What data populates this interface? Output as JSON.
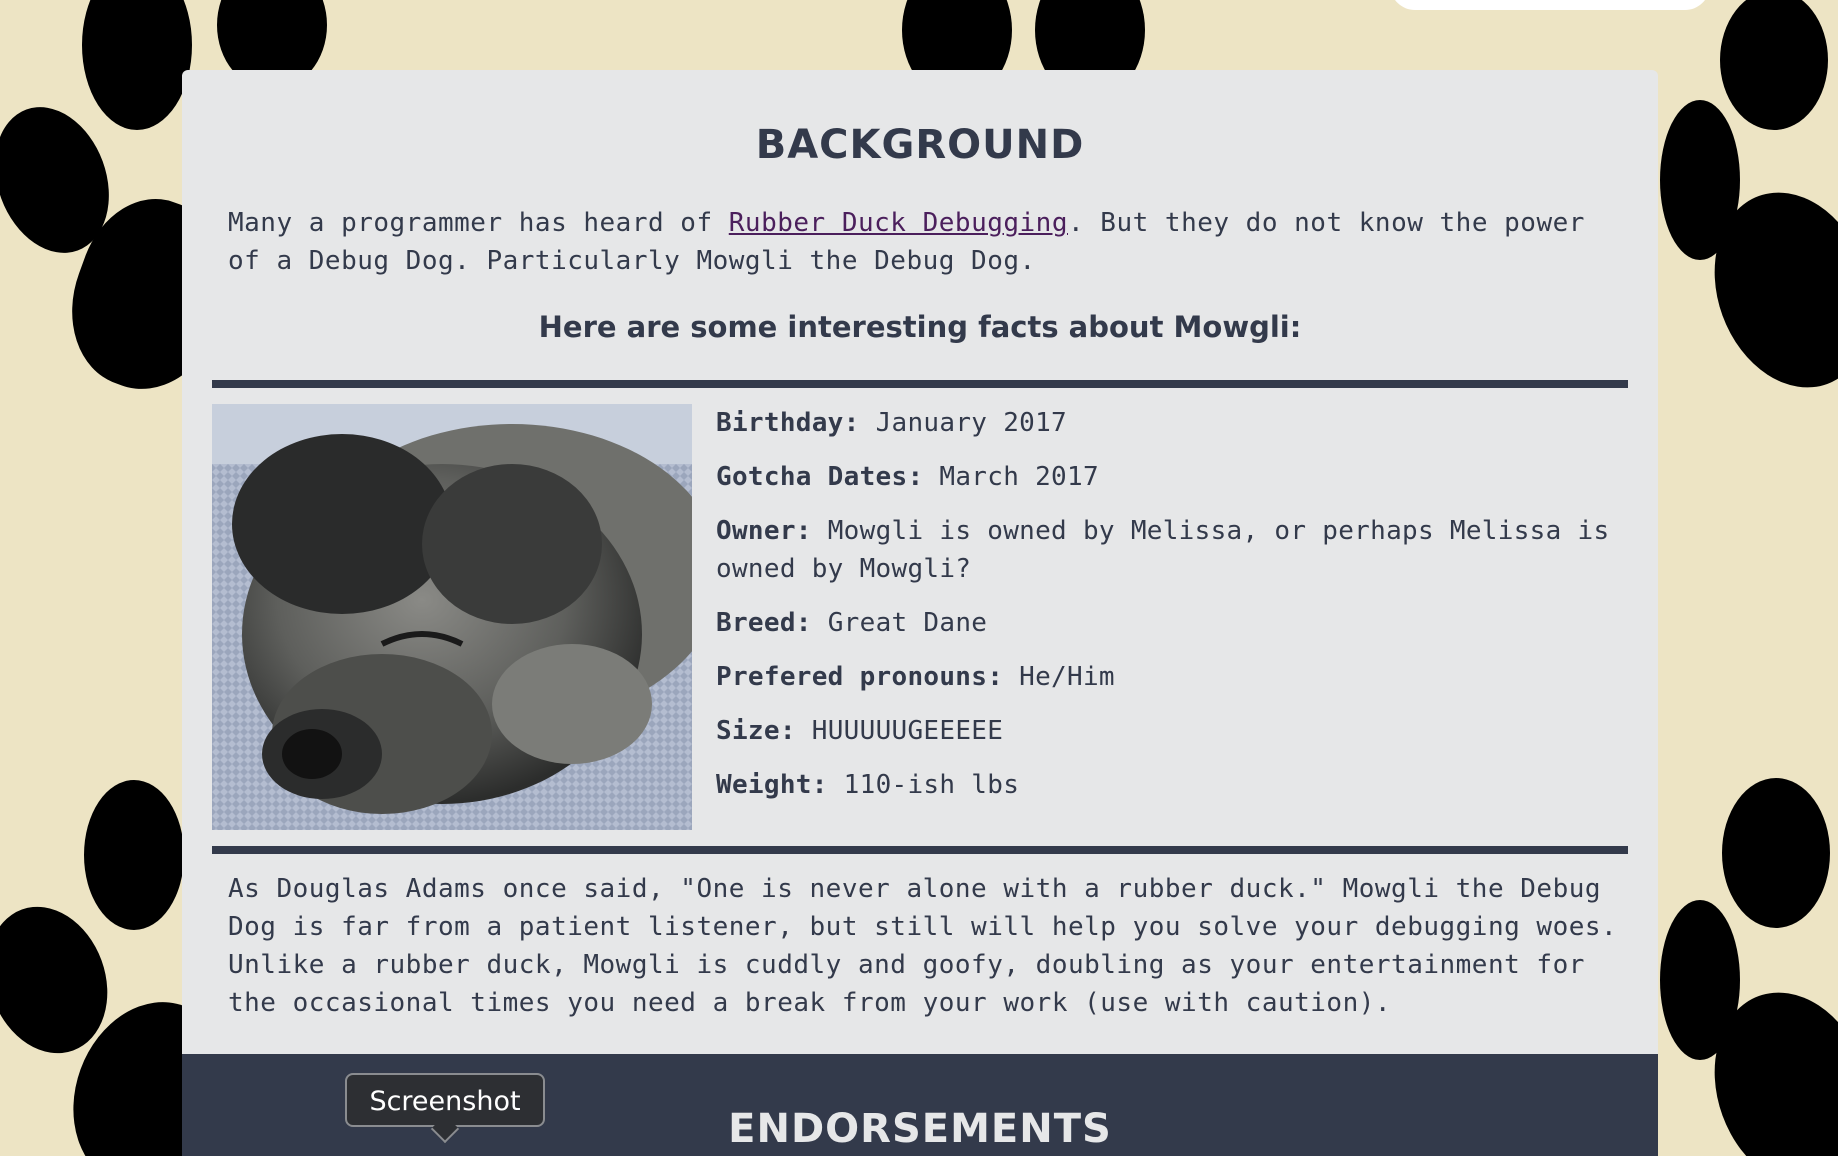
{
  "background_section": {
    "title": "BACKGROUND",
    "intro_before_link": "Many a programmer has heard of ",
    "intro_link": "Rubber Duck Debugging",
    "intro_after_link": ". But they do not know the power of a Debug Dog. Particularly Mowgli the Debug Dog.",
    "facts_heading": "Here are some interesting facts about Mowgli:"
  },
  "facts": [
    {
      "label": "Birthday:",
      "value": "January 2017"
    },
    {
      "label": "Gotcha Dates:",
      "value": "March 2017"
    },
    {
      "label": "Owner:",
      "value": "Mowgli is owned by Melissa, or perhaps Melissa is owned by Mowgli?"
    },
    {
      "label": "Breed:",
      "value": "Great Dane"
    },
    {
      "label": "Prefered pronouns:",
      "value": "He/Him"
    },
    {
      "label": "Size:",
      "value": "HUUUUUGEEEEE"
    },
    {
      "label": "Weight:",
      "value": "110-ish lbs"
    }
  ],
  "quote": "As Douglas Adams once said, \"One is never alone with a rubber duck.\" Mowgli the Debug Dog is far from a patient listener, but still will help you solve your debugging woes. Unlike a rubber duck, Mowgli is cuddly and goofy, doubling as your entertainment for the occasional times you need a break from your work (use with caution).",
  "endorsements": {
    "title": "ENDORSEMENTS"
  },
  "tooltip": {
    "label": "Screenshot"
  },
  "colors": {
    "page_background": "#ede4c4",
    "card_background": "#e6e7e8",
    "text_dark": "#333a4b",
    "link": "#4b1f5c",
    "paw": "#000000"
  },
  "icons": {
    "background_pattern": "paw-print-icon",
    "photo": "puppy-photo"
  }
}
